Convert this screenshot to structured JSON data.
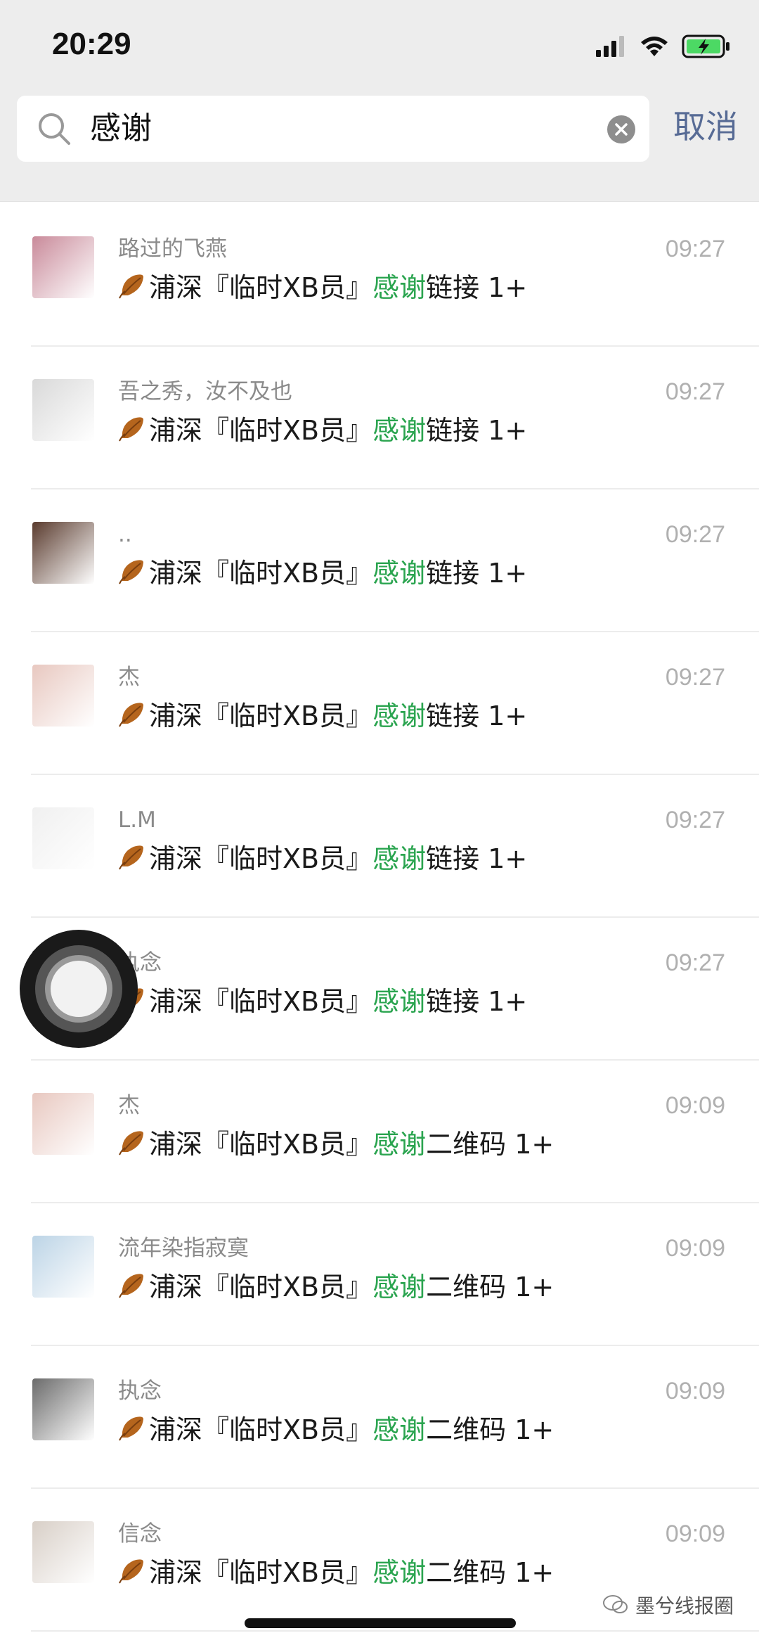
{
  "status_bar": {
    "time": "20:29"
  },
  "search": {
    "query": "感谢",
    "cancel_label": "取消"
  },
  "results": [
    {
      "name": "路过的飞燕",
      "time": "09:27",
      "group": "浦深『临时XB员』",
      "keyword": "感谢",
      "suffix": "链接 1+",
      "avatar_color": "#c98a9a"
    },
    {
      "name": "吾之秀，汝不及也",
      "time": "09:27",
      "group": "浦深『临时XB员』",
      "keyword": "感谢",
      "suffix": "链接 1+",
      "avatar_color": "#d9d9d9"
    },
    {
      "name": "..",
      "time": "09:27",
      "group": "浦深『临时XB员』",
      "keyword": "感谢",
      "suffix": "链接 1+",
      "avatar_color": "#5a3b2e"
    },
    {
      "name": "杰",
      "time": "09:27",
      "group": "浦深『临时XB员』",
      "keyword": "感谢",
      "suffix": "链接 1+",
      "avatar_color": "#e8c8c0"
    },
    {
      "name": "L.M",
      "time": "09:27",
      "group": "浦深『临时XB员』",
      "keyword": "感谢",
      "suffix": "链接 1+",
      "avatar_color": "#f0f0f0"
    },
    {
      "name": "执念",
      "time": "09:27",
      "group": "浦深『临时XB员』",
      "keyword": "感谢",
      "suffix": "链接 1+",
      "avatar_color": "#6b6b6b"
    },
    {
      "name": "杰",
      "time": "09:09",
      "group": "浦深『临时XB员』",
      "keyword": "感谢",
      "suffix": "二维码 1+",
      "avatar_color": "#e8c8c0"
    },
    {
      "name": "流年染指寂寞",
      "time": "09:09",
      "group": "浦深『临时XB员』",
      "keyword": "感谢",
      "suffix": "二维码 1+",
      "avatar_color": "#bcd4e6"
    },
    {
      "name": "执念",
      "time": "09:09",
      "group": "浦深『临时XB员』",
      "keyword": "感谢",
      "suffix": "二维码 1+",
      "avatar_color": "#6b6b6b"
    },
    {
      "name": "信念",
      "time": "09:09",
      "group": "浦深『临时XB员』",
      "keyword": "感谢",
      "suffix": "二维码 1+",
      "avatar_color": "#d8cfc7"
    }
  ],
  "watermark": {
    "text": "墨兮线报圈"
  },
  "colors": {
    "highlight": "#2aa44f",
    "link": "#576b95",
    "background": "#ededed"
  }
}
